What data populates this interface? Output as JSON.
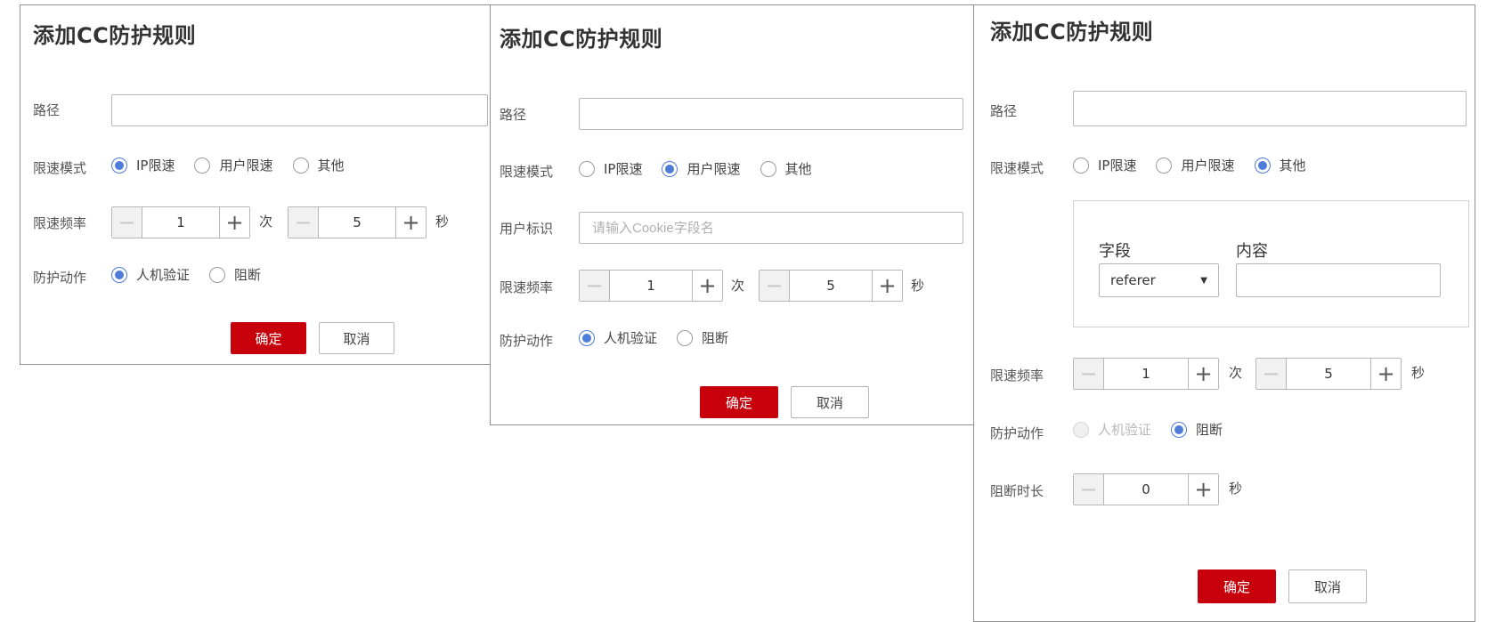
{
  "dialog1": {
    "title": "添加CC防护规则",
    "path_label": "路径",
    "path_value": "",
    "mode_label": "限速模式",
    "mode_options": [
      "IP限速",
      "用户限速",
      "其他"
    ],
    "mode_selected": "IP限速",
    "freq_label": "限速频率",
    "count_value": "1",
    "count_unit": "次",
    "seconds_value": "5",
    "seconds_unit": "秒",
    "action_label": "防护动作",
    "action_options": [
      "人机验证",
      "阻断"
    ],
    "action_selected": "人机验证",
    "ok_label": "确定",
    "cancel_label": "取消"
  },
  "dialog2": {
    "title": "添加CC防护规则",
    "path_label": "路径",
    "path_value": "",
    "mode_label": "限速模式",
    "mode_options": [
      "IP限速",
      "用户限速",
      "其他"
    ],
    "mode_selected": "用户限速",
    "user_id_label": "用户标识",
    "user_id_placeholder": "请输入Cookie字段名",
    "freq_label": "限速频率",
    "count_value": "1",
    "count_unit": "次",
    "seconds_value": "5",
    "seconds_unit": "秒",
    "action_label": "防护动作",
    "action_options": [
      "人机验证",
      "阻断"
    ],
    "action_selected": "人机验证",
    "ok_label": "确定",
    "cancel_label": "取消"
  },
  "dialog3": {
    "title": "添加CC防护规则",
    "path_label": "路径",
    "path_value": "",
    "mode_label": "限速模式",
    "mode_options": [
      "IP限速",
      "用户限速",
      "其他"
    ],
    "mode_selected": "其他",
    "field_header": "字段",
    "content_header": "内容",
    "field_value": "referer",
    "content_value": "",
    "freq_label": "限速频率",
    "count_value": "1",
    "count_unit": "次",
    "seconds_value": "5",
    "seconds_unit": "秒",
    "action_label": "防护动作",
    "action_options": [
      "人机验证",
      "阻断"
    ],
    "action_selected": "阻断",
    "action_disabled": "人机验证",
    "block_label": "阻断时长",
    "block_value": "0",
    "block_unit": "秒",
    "ok_label": "确定",
    "cancel_label": "取消"
  },
  "colors": {
    "primary_button": "#c7000b",
    "radio_selected": "#4e7cd8",
    "dialog_border": "#8f8f8f"
  },
  "icons": {
    "minus": "minus-icon",
    "plus": "plus-icon",
    "dropdown": "chevron-down-icon"
  }
}
